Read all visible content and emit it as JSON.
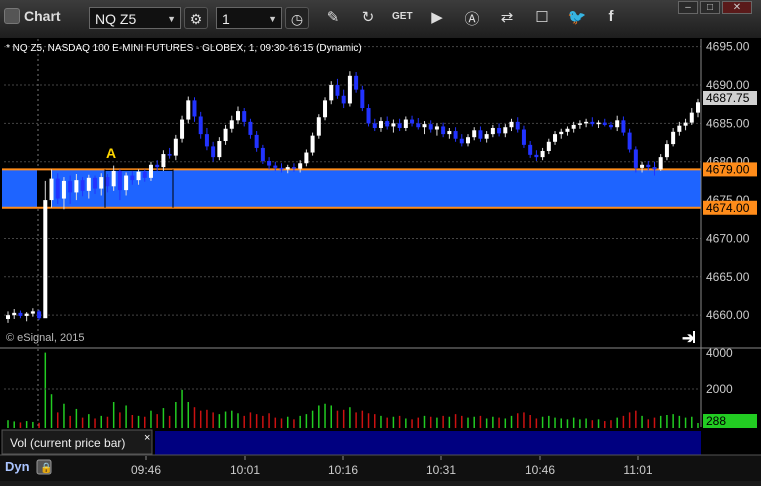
{
  "toolbar": {
    "title": "Chart",
    "symbol": "NQ Z5",
    "interval": "1",
    "icons": [
      "gear-icon",
      "clock-icon",
      "pencil-icon",
      "refresh-icon",
      "get-icon",
      "play-icon",
      "alert-icon",
      "link-icon",
      "comment-icon",
      "twitter-icon",
      "facebook-icon"
    ],
    "window_buttons": [
      "minimize",
      "maximize",
      "close"
    ]
  },
  "chart": {
    "header": "* NQ Z5, NASDAQ 100 E-MINI FUTURES - GLOBEX, 1, 09:30-16:15 (Dynamic)",
    "copyright": "© eSignal, 2015",
    "last_price_label": "4687.75",
    "upper_line_label": "4679.00",
    "lower_line_label": "4674.00",
    "annotation_letter": "A",
    "colors": {
      "background": "#000000",
      "up": "#ffffff",
      "down": "#2233ff",
      "band": "#1e64ff",
      "band_line": "#ff8c1a",
      "volume_up": "#22cc22",
      "volume_down": "#cc1111"
    }
  },
  "volume_panel": {
    "label": "Vol (current price bar)",
    "close_glyph": "×",
    "current_value": "288",
    "y_ticks": [
      "4000",
      "2000"
    ]
  },
  "time_axis": {
    "mode_label": "Dyn",
    "ticks": [
      "09:46",
      "10:01",
      "10:16",
      "10:31",
      "10:46",
      "11:01"
    ]
  },
  "chart_data": {
    "type": "candlestick",
    "y_ticks": [
      4695,
      4690,
      4685,
      4680,
      4675,
      4670,
      4665,
      4660
    ],
    "y_tick_labels": [
      "4695.00",
      "4690.00",
      "4685.00",
      "4680.00",
      "4675.00",
      "4670.00",
      "4665.00",
      "4660.00"
    ],
    "ylim": [
      4656.5,
      4696
    ],
    "band": [
      4674,
      4679
    ],
    "last_price": 4687.75,
    "volume_ylim": [
      0,
      4500
    ],
    "volume_ticks": [
      4000,
      2000
    ],
    "candles": [
      [
        4659.5,
        4660.5,
        4659.0,
        4660.0,
        450
      ],
      [
        4660.0,
        4660.8,
        4659.5,
        4660.3,
        380
      ],
      [
        4660.3,
        4660.6,
        4659.6,
        4659.9,
        320
      ],
      [
        4659.9,
        4660.4,
        4659.2,
        4660.2,
        400
      ],
      [
        4660.2,
        4660.9,
        4659.8,
        4660.5,
        350
      ],
      [
        4660.5,
        4660.7,
        4659.4,
        4659.6,
        300
      ],
      [
        4659.6,
        4677.5,
        4674.0,
        4675.0,
        4350
      ],
      [
        4675.0,
        4679.0,
        4674.0,
        4677.8,
        1950
      ],
      [
        4677.8,
        4678.5,
        4674.5,
        4675.2,
        900
      ],
      [
        4675.2,
        4678.0,
        4673.8,
        4677.5,
        1400
      ],
      [
        4677.5,
        4678.2,
        4674.5,
        4676.0,
        700
      ],
      [
        4676.0,
        4678.4,
        4675.0,
        4677.6,
        1100
      ],
      [
        4677.6,
        4678.0,
        4675.5,
        4676.2,
        600
      ],
      [
        4676.2,
        4678.3,
        4675.2,
        4677.9,
        800
      ],
      [
        4677.9,
        4678.2,
        4675.8,
        4676.5,
        550
      ],
      [
        4676.5,
        4678.5,
        4675.6,
        4678.0,
        700
      ],
      [
        4678.0,
        4678.4,
        4676.0,
        4676.8,
        650
      ],
      [
        4676.8,
        4679.5,
        4676.2,
        4678.8,
        1500
      ],
      [
        4678.8,
        4679.0,
        4675.0,
        4676.3,
        900
      ],
      [
        4676.3,
        4678.6,
        4675.6,
        4678.2,
        1300
      ],
      [
        4678.2,
        4678.8,
        4677.0,
        4677.6,
        750
      ],
      [
        4677.6,
        4679.0,
        4677.0,
        4678.7,
        700
      ],
      [
        4678.7,
        4679.0,
        4677.4,
        4677.9,
        650
      ],
      [
        4677.9,
        4680.0,
        4677.5,
        4679.6,
        1000
      ],
      [
        4679.6,
        4680.2,
        4678.8,
        4679.3,
        800
      ],
      [
        4679.3,
        4681.5,
        4678.8,
        4681.0,
        1150
      ],
      [
        4681.0,
        4681.8,
        4680.4,
        4680.8,
        700
      ],
      [
        4680.8,
        4683.5,
        4680.2,
        4683.0,
        1500
      ],
      [
        4683.0,
        4686.0,
        4682.5,
        4685.5,
        2200
      ],
      [
        4685.5,
        4688.5,
        4685.0,
        4688.0,
        1500
      ],
      [
        4688.0,
        4688.4,
        4685.2,
        4685.9,
        1200
      ],
      [
        4685.9,
        4686.5,
        4683.0,
        4683.6,
        1000
      ],
      [
        4683.6,
        4684.4,
        4681.5,
        4682.0,
        1050
      ],
      [
        4682.0,
        4682.6,
        4680.0,
        4680.6,
        900
      ],
      [
        4680.6,
        4683.2,
        4680.2,
        4682.7,
        800
      ],
      [
        4682.7,
        4684.8,
        4682.2,
        4684.3,
        950
      ],
      [
        4684.3,
        4686.0,
        4683.8,
        4685.4,
        1000
      ],
      [
        4685.4,
        4687.2,
        4684.9,
        4686.6,
        850
      ],
      [
        4686.6,
        4687.0,
        4684.6,
        4685.2,
        700
      ],
      [
        4685.2,
        4685.6,
        4683.0,
        4683.5,
        900
      ],
      [
        4683.5,
        4684.0,
        4681.3,
        4681.8,
        800
      ],
      [
        4681.8,
        4682.2,
        4679.7,
        4680.1,
        700
      ],
      [
        4680.1,
        4680.6,
        4679.0,
        4679.5,
        850
      ],
      [
        4679.5,
        4680.0,
        4678.8,
        4679.2,
        600
      ],
      [
        4679.2,
        4679.8,
        4678.6,
        4679.0,
        550
      ],
      [
        4679.0,
        4679.6,
        4678.5,
        4679.3,
        650
      ],
      [
        4679.3,
        4679.8,
        4678.7,
        4679.1,
        500
      ],
      [
        4679.1,
        4680.2,
        4678.6,
        4679.8,
        700
      ],
      [
        4679.8,
        4681.6,
        4679.4,
        4681.2,
        800
      ],
      [
        4681.2,
        4683.8,
        4680.8,
        4683.4,
        1000
      ],
      [
        4683.4,
        4686.2,
        4683.0,
        4685.8,
        1300
      ],
      [
        4685.8,
        4688.4,
        4685.4,
        4688.0,
        1400
      ],
      [
        4688.0,
        4690.5,
        4687.5,
        4690.0,
        1300
      ],
      [
        4690.0,
        4690.8,
        4688.2,
        4688.6,
        1000
      ],
      [
        4688.6,
        4689.4,
        4687.0,
        4687.6,
        1050
      ],
      [
        4687.6,
        4691.8,
        4687.2,
        4691.2,
        1200
      ],
      [
        4691.2,
        4691.7,
        4689.0,
        4689.4,
        900
      ],
      [
        4689.4,
        4689.9,
        4686.6,
        4687.0,
        1000
      ],
      [
        4687.0,
        4687.5,
        4684.6,
        4685.0,
        850
      ],
      [
        4685.0,
        4685.6,
        4684.0,
        4684.4,
        800
      ],
      [
        4684.4,
        4685.8,
        4683.9,
        4685.3,
        700
      ],
      [
        4685.3,
        4685.9,
        4684.2,
        4684.6,
        600
      ],
      [
        4684.6,
        4685.5,
        4683.8,
        4685.0,
        650
      ],
      [
        4685.0,
        4685.6,
        4684.0,
        4684.4,
        700
      ],
      [
        4684.4,
        4685.9,
        4684.0,
        4685.5,
        550
      ],
      [
        4685.5,
        4686.0,
        4684.6,
        4685.0,
        500
      ],
      [
        4685.0,
        4685.7,
        4684.2,
        4684.5,
        600
      ],
      [
        4684.5,
        4685.3,
        4683.6,
        4684.9,
        700
      ],
      [
        4684.9,
        4685.4,
        4683.8,
        4684.2,
        650
      ],
      [
        4684.2,
        4685.0,
        4683.4,
        4684.6,
        600
      ],
      [
        4684.6,
        4685.1,
        4683.2,
        4683.6,
        700
      ],
      [
        4683.6,
        4684.4,
        4683.0,
        4684.0,
        650
      ],
      [
        4684.0,
        4684.5,
        4682.6,
        4683.0,
        800
      ],
      [
        4683.0,
        4683.6,
        4682.0,
        4682.4,
        700
      ],
      [
        4682.4,
        4683.6,
        4682.0,
        4683.2,
        600
      ],
      [
        4683.2,
        4684.5,
        4682.8,
        4684.1,
        650
      ],
      [
        4684.1,
        4684.6,
        4682.6,
        4683.0,
        700
      ],
      [
        4683.0,
        4684.0,
        4682.5,
        4683.6,
        550
      ],
      [
        4683.6,
        4684.8,
        4683.2,
        4684.4,
        650
      ],
      [
        4684.4,
        4685.0,
        4683.3,
        4683.7,
        600
      ],
      [
        4683.7,
        4684.9,
        4683.2,
        4684.5,
        550
      ],
      [
        4684.5,
        4685.6,
        4684.0,
        4685.2,
        700
      ],
      [
        4685.2,
        4685.8,
        4683.8,
        4684.2,
        850
      ],
      [
        4684.2,
        4684.7,
        4681.8,
        4682.2,
        900
      ],
      [
        4682.2,
        4682.7,
        4680.5,
        4680.9,
        750
      ],
      [
        4680.9,
        4681.5,
        4680.1,
        4680.6,
        550
      ],
      [
        4680.6,
        4681.8,
        4680.2,
        4681.4,
        650
      ],
      [
        4681.4,
        4683.0,
        4681.0,
        4682.6,
        700
      ],
      [
        4682.6,
        4684.0,
        4682.2,
        4683.6,
        600
      ],
      [
        4683.6,
        4684.3,
        4683.0,
        4683.9,
        550
      ],
      [
        4683.9,
        4684.6,
        4683.4,
        4684.3,
        500
      ],
      [
        4684.3,
        4685.2,
        4683.8,
        4684.8,
        600
      ],
      [
        4684.8,
        4685.4,
        4684.3,
        4685.0,
        500
      ],
      [
        4685.0,
        4685.6,
        4684.5,
        4685.2,
        550
      ],
      [
        4685.2,
        4685.8,
        4684.6,
        4684.9,
        450
      ],
      [
        4684.9,
        4685.4,
        4684.4,
        4685.1,
        500
      ],
      [
        4685.1,
        4685.6,
        4684.6,
        4684.8,
        400
      ],
      [
        4684.8,
        4685.2,
        4684.2,
        4684.5,
        450
      ],
      [
        4684.5,
        4686.0,
        4684.0,
        4685.4,
        600
      ],
      [
        4685.4,
        4685.9,
        4683.4,
        4683.8,
        700
      ],
      [
        4683.8,
        4684.3,
        4681.2,
        4681.6,
        900
      ],
      [
        4681.6,
        4682.0,
        4678.6,
        4679.2,
        1000
      ],
      [
        4679.2,
        4680.0,
        4678.6,
        4679.6,
        700
      ],
      [
        4679.6,
        4680.1,
        4678.9,
        4679.3,
        500
      ],
      [
        4679.3,
        4680.0,
        4678.2,
        4679.0,
        600
      ],
      [
        4679.0,
        4681.0,
        4678.8,
        4680.6,
        700
      ],
      [
        4680.6,
        4682.8,
        4680.2,
        4682.3,
        750
      ],
      [
        4682.3,
        4684.4,
        4682.0,
        4683.9,
        800
      ],
      [
        4683.9,
        4685.2,
        4683.4,
        4684.7,
        700
      ],
      [
        4684.7,
        4685.6,
        4684.1,
        4685.1,
        600
      ],
      [
        4685.1,
        4687.0,
        4684.8,
        4686.4,
        650
      ],
      [
        4686.4,
        4688.2,
        4685.8,
        4687.75,
        288
      ]
    ]
  }
}
